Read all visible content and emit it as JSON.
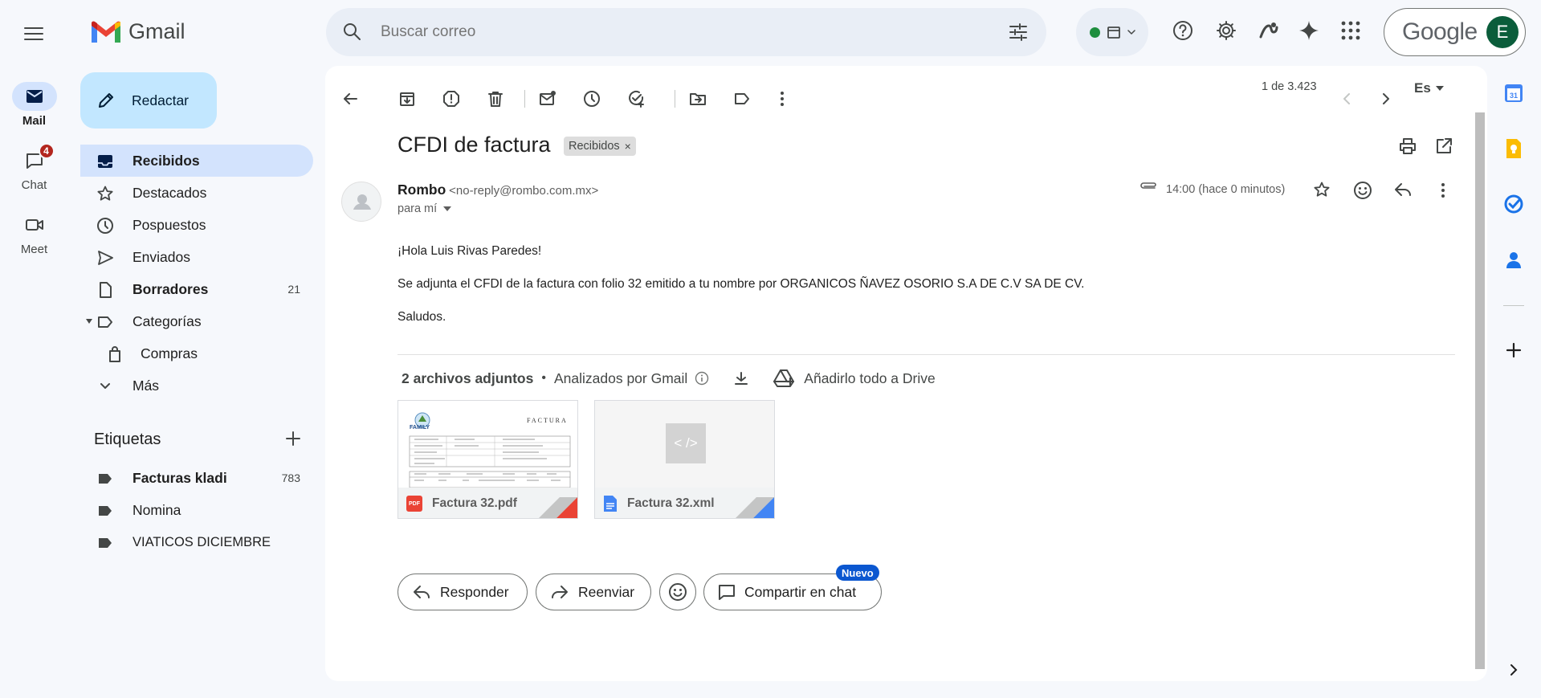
{
  "app": {
    "name": "Gmail",
    "brand_color": "#ea4335"
  },
  "rail": {
    "mail": "Mail",
    "chat": "Chat",
    "chat_badge": "4",
    "meet": "Meet"
  },
  "compose": {
    "label": "Redactar"
  },
  "nav": [
    {
      "label": "Recibidos",
      "count": ""
    },
    {
      "label": "Destacados",
      "count": ""
    },
    {
      "label": "Pospuestos",
      "count": ""
    },
    {
      "label": "Enviados",
      "count": ""
    },
    {
      "label": "Borradores",
      "count": "21"
    },
    {
      "label": "Categorías",
      "count": ""
    },
    {
      "label": "Compras",
      "count": ""
    },
    {
      "label": "Más",
      "count": ""
    }
  ],
  "labels": {
    "title": "Etiquetas",
    "items": [
      {
        "label": "Facturas kladi",
        "count": "783"
      },
      {
        "label": "Nomina",
        "count": ""
      },
      {
        "label": "VIATICOS DICIEMBRE",
        "count": ""
      }
    ]
  },
  "search": {
    "placeholder": "Buscar correo"
  },
  "header": {
    "google_logo": "Google",
    "avatar_letter": "E",
    "status_color": "#1e8e3e"
  },
  "toolbar": {
    "pagination": "1 de 3.423",
    "lang": "Es"
  },
  "email": {
    "subject": "CFDI de factura",
    "label_chip": "Recibidos",
    "sender_name": "Rombo",
    "sender_email": "<no-reply@rombo.com.mx>",
    "to": "para mí",
    "time": "14:00 (hace 0 minutos)",
    "body": [
      "¡Hola Luis Rivas Paredes!",
      "Se adjunta el CFDI de la factura con folio 32 emitido a tu nombre por ORGANICOS ÑAVEZ OSORIO S.A DE C.V SA DE CV.",
      "Saludos."
    ]
  },
  "attachments": {
    "count_label": "2 archivos adjuntos",
    "scanned": "Analizados por Gmail",
    "drive": "Añadirlo todo a Drive",
    "files": [
      {
        "name": "Factura 32.pdf",
        "type": "PDF",
        "color": "#ea4335",
        "preview_title": "FACTURA",
        "preview_brand": "FAMILY"
      },
      {
        "name": "Factura 32.xml",
        "type": "XML",
        "color": "#4285f4",
        "preview_code": "< />"
      }
    ]
  },
  "actions": {
    "reply": "Responder",
    "forward": "Reenviar",
    "share_chat": "Compartir en chat",
    "new_badge": "Nuevo"
  }
}
